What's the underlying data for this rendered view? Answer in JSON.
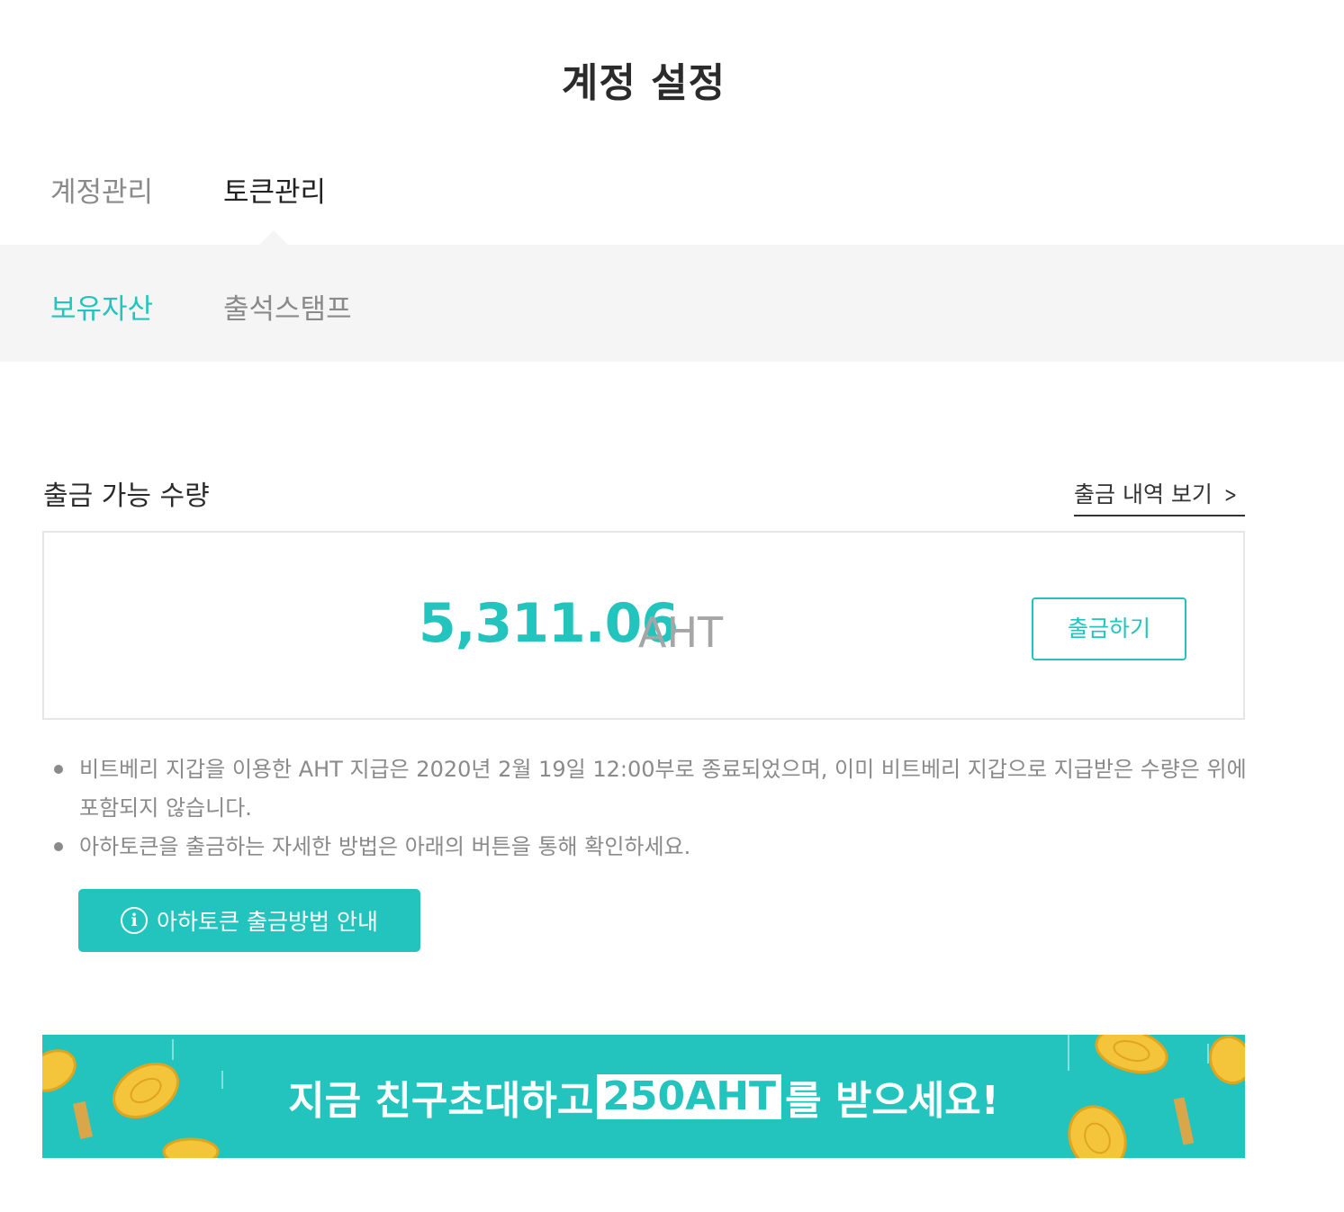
{
  "page_title": "계정 설정",
  "main_tabs": [
    {
      "label": "계정관리",
      "active": false
    },
    {
      "label": "토큰관리",
      "active": true
    }
  ],
  "sub_tabs": [
    {
      "label": "보유자산",
      "active": true
    },
    {
      "label": "출석스탬프",
      "active": false
    }
  ],
  "withdrawable": {
    "title": "출금 가능 수량",
    "history_link": "출금 내역 보기",
    "amount": "5,311.06",
    "unit": "AHT",
    "withdraw_button": "출금하기"
  },
  "notes": [
    "비트베리 지갑을 이용한 AHT 지급은 2020년 2월 19일 12:00부로 종료되었으며, 이미 비트베리 지갑으로 지급받은 수량은 위에 포함되지 않습니다.",
    "아하토큰을 출금하는 자세한 방법은 아래의 버튼을 통해 확인하세요."
  ],
  "guide_button": "아하토큰 출금방법 안내",
  "banner": {
    "text_before": "지금 친구초대하고",
    "highlight": "250AHT",
    "text_after": "를 받으세요!"
  },
  "colors": {
    "accent": "#22c4bd",
    "band": "#f5f5f5",
    "muted_text": "#8a8a8a"
  }
}
